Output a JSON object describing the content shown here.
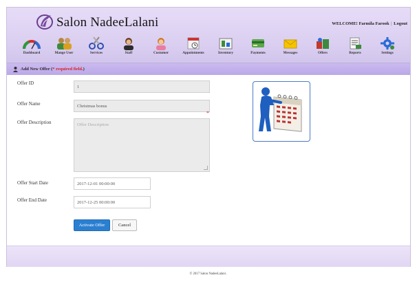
{
  "header": {
    "app_title": "Salon NadeeLalani",
    "welcome_text": "WELCOME! Farmila Farook",
    "separator": "|",
    "logout_label": "Logout"
  },
  "nav": {
    "items": [
      {
        "label": "Dashboard",
        "icon": "dashboard-icon"
      },
      {
        "label": "Mange User",
        "icon": "users-icon"
      },
      {
        "label": "Services",
        "icon": "scissors-icon"
      },
      {
        "label": "Staff",
        "icon": "staff-icon"
      },
      {
        "label": "Customer",
        "icon": "customer-icon"
      },
      {
        "label": "Appointments",
        "icon": "calendar-clock-icon"
      },
      {
        "label": "Inventory",
        "icon": "inventory-icon"
      },
      {
        "label": "Payments",
        "icon": "payments-icon"
      },
      {
        "label": "Messages",
        "icon": "envelope-icon"
      },
      {
        "label": "Offers",
        "icon": "offers-icon"
      },
      {
        "label": "Reports",
        "icon": "reports-icon"
      },
      {
        "label": "Settings",
        "icon": "gear-icon"
      }
    ]
  },
  "page": {
    "title": "Add New Offer",
    "title_open": "(",
    "required_note": "* required field.",
    "title_close": ")"
  },
  "form": {
    "offer_id_label": "Offer ID",
    "offer_id_value": "1",
    "offer_name_label": "Offer Name",
    "offer_name_value": "Christmas bonus",
    "required_star": "*",
    "description_label": "Offer Description",
    "description_placeholder": "Offer Description",
    "start_label": "Offer Start Date",
    "start_value": "2017-12-01 00:00:00",
    "end_label": "Offer End Date",
    "end_value": "2017-12-25 00:00:00",
    "activate_label": "Activate Offer",
    "cancel_label": "Cancel"
  },
  "footer": {
    "copyright": "© 2017 Salon NadeeLalani ."
  },
  "colors": {
    "header_bg": "#dcd0f2",
    "titlebar_bg": "#c4b2ee",
    "primary_button": "#2b7fd1",
    "required_red": "#d61f1f"
  }
}
